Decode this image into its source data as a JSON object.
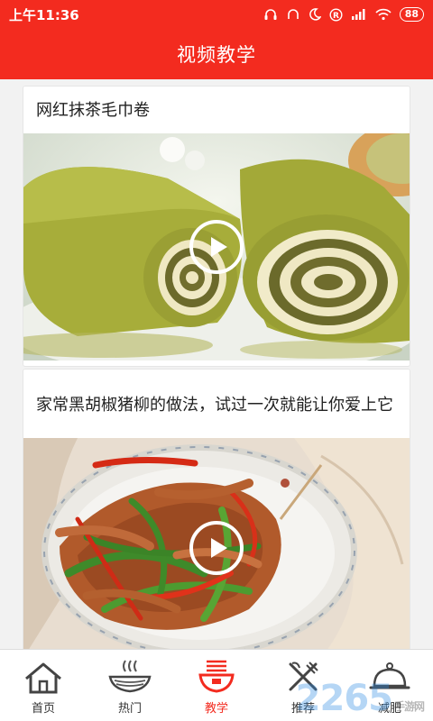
{
  "status_bar": {
    "time": "上午11:36",
    "battery": "88",
    "icons": [
      "headset-icon",
      "headphones-icon",
      "moon-icon",
      "registered-icon",
      "signal-icon",
      "wifi-icon",
      "battery-icon"
    ]
  },
  "header": {
    "title": "视频教学"
  },
  "feed": {
    "items": [
      {
        "title": "网红抹茶毛巾卷",
        "media": "video",
        "play_icon": "play-icon"
      },
      {
        "title": "家常黑胡椒猪柳的做法，试过一次就能让你爱上它",
        "media": "video",
        "play_icon": "play-icon"
      }
    ]
  },
  "tabs": [
    {
      "label": "首页",
      "icon": "house-icon",
      "active": false
    },
    {
      "label": "热门",
      "icon": "noodle-bowl-icon",
      "active": false
    },
    {
      "label": "教学",
      "icon": "steaming-bowl-icon",
      "active": true
    },
    {
      "label": "推荐",
      "icon": "fork-knife-icon",
      "active": false
    },
    {
      "label": "减肥",
      "icon": "cloche-icon",
      "active": false
    }
  ],
  "watermark": {
    "text": "2265",
    "suffix": "手游网"
  },
  "colors": {
    "brand": "#f32b1f",
    "tab_text": "#333333",
    "card_bg": "#ffffff",
    "page_bg": "#f2f2f2"
  }
}
